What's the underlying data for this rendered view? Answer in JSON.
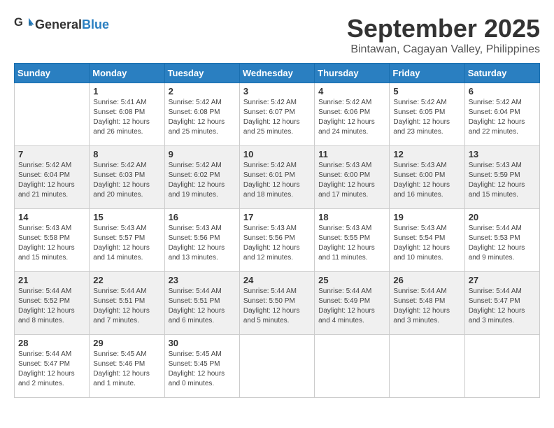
{
  "header": {
    "logo_general": "General",
    "logo_blue": "Blue",
    "month": "September 2025",
    "location": "Bintawan, Cagayan Valley, Philippines"
  },
  "calendar": {
    "days_of_week": [
      "Sunday",
      "Monday",
      "Tuesday",
      "Wednesday",
      "Thursday",
      "Friday",
      "Saturday"
    ],
    "weeks": [
      [
        {
          "day": "",
          "info": ""
        },
        {
          "day": "1",
          "info": "Sunrise: 5:41 AM\nSunset: 6:08 PM\nDaylight: 12 hours\nand 26 minutes."
        },
        {
          "day": "2",
          "info": "Sunrise: 5:42 AM\nSunset: 6:08 PM\nDaylight: 12 hours\nand 25 minutes."
        },
        {
          "day": "3",
          "info": "Sunrise: 5:42 AM\nSunset: 6:07 PM\nDaylight: 12 hours\nand 25 minutes."
        },
        {
          "day": "4",
          "info": "Sunrise: 5:42 AM\nSunset: 6:06 PM\nDaylight: 12 hours\nand 24 minutes."
        },
        {
          "day": "5",
          "info": "Sunrise: 5:42 AM\nSunset: 6:05 PM\nDaylight: 12 hours\nand 23 minutes."
        },
        {
          "day": "6",
          "info": "Sunrise: 5:42 AM\nSunset: 6:04 PM\nDaylight: 12 hours\nand 22 minutes."
        }
      ],
      [
        {
          "day": "7",
          "info": "Sunrise: 5:42 AM\nSunset: 6:04 PM\nDaylight: 12 hours\nand 21 minutes."
        },
        {
          "day": "8",
          "info": "Sunrise: 5:42 AM\nSunset: 6:03 PM\nDaylight: 12 hours\nand 20 minutes."
        },
        {
          "day": "9",
          "info": "Sunrise: 5:42 AM\nSunset: 6:02 PM\nDaylight: 12 hours\nand 19 minutes."
        },
        {
          "day": "10",
          "info": "Sunrise: 5:42 AM\nSunset: 6:01 PM\nDaylight: 12 hours\nand 18 minutes."
        },
        {
          "day": "11",
          "info": "Sunrise: 5:43 AM\nSunset: 6:00 PM\nDaylight: 12 hours\nand 17 minutes."
        },
        {
          "day": "12",
          "info": "Sunrise: 5:43 AM\nSunset: 6:00 PM\nDaylight: 12 hours\nand 16 minutes."
        },
        {
          "day": "13",
          "info": "Sunrise: 5:43 AM\nSunset: 5:59 PM\nDaylight: 12 hours\nand 15 minutes."
        }
      ],
      [
        {
          "day": "14",
          "info": "Sunrise: 5:43 AM\nSunset: 5:58 PM\nDaylight: 12 hours\nand 15 minutes."
        },
        {
          "day": "15",
          "info": "Sunrise: 5:43 AM\nSunset: 5:57 PM\nDaylight: 12 hours\nand 14 minutes."
        },
        {
          "day": "16",
          "info": "Sunrise: 5:43 AM\nSunset: 5:56 PM\nDaylight: 12 hours\nand 13 minutes."
        },
        {
          "day": "17",
          "info": "Sunrise: 5:43 AM\nSunset: 5:56 PM\nDaylight: 12 hours\nand 12 minutes."
        },
        {
          "day": "18",
          "info": "Sunrise: 5:43 AM\nSunset: 5:55 PM\nDaylight: 12 hours\nand 11 minutes."
        },
        {
          "day": "19",
          "info": "Sunrise: 5:43 AM\nSunset: 5:54 PM\nDaylight: 12 hours\nand 10 minutes."
        },
        {
          "day": "20",
          "info": "Sunrise: 5:44 AM\nSunset: 5:53 PM\nDaylight: 12 hours\nand 9 minutes."
        }
      ],
      [
        {
          "day": "21",
          "info": "Sunrise: 5:44 AM\nSunset: 5:52 PM\nDaylight: 12 hours\nand 8 minutes."
        },
        {
          "day": "22",
          "info": "Sunrise: 5:44 AM\nSunset: 5:51 PM\nDaylight: 12 hours\nand 7 minutes."
        },
        {
          "day": "23",
          "info": "Sunrise: 5:44 AM\nSunset: 5:51 PM\nDaylight: 12 hours\nand 6 minutes."
        },
        {
          "day": "24",
          "info": "Sunrise: 5:44 AM\nSunset: 5:50 PM\nDaylight: 12 hours\nand 5 minutes."
        },
        {
          "day": "25",
          "info": "Sunrise: 5:44 AM\nSunset: 5:49 PM\nDaylight: 12 hours\nand 4 minutes."
        },
        {
          "day": "26",
          "info": "Sunrise: 5:44 AM\nSunset: 5:48 PM\nDaylight: 12 hours\nand 3 minutes."
        },
        {
          "day": "27",
          "info": "Sunrise: 5:44 AM\nSunset: 5:47 PM\nDaylight: 12 hours\nand 3 minutes."
        }
      ],
      [
        {
          "day": "28",
          "info": "Sunrise: 5:44 AM\nSunset: 5:47 PM\nDaylight: 12 hours\nand 2 minutes."
        },
        {
          "day": "29",
          "info": "Sunrise: 5:45 AM\nSunset: 5:46 PM\nDaylight: 12 hours\nand 1 minute."
        },
        {
          "day": "30",
          "info": "Sunrise: 5:45 AM\nSunset: 5:45 PM\nDaylight: 12 hours\nand 0 minutes."
        },
        {
          "day": "",
          "info": ""
        },
        {
          "day": "",
          "info": ""
        },
        {
          "day": "",
          "info": ""
        },
        {
          "day": "",
          "info": ""
        }
      ]
    ]
  }
}
